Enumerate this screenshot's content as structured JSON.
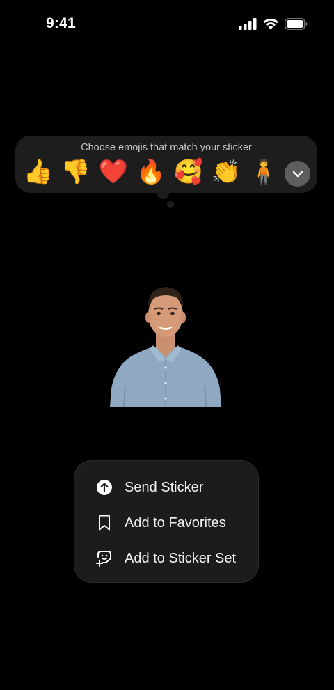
{
  "status_bar": {
    "time": "9:41",
    "icons": [
      "cellular-signal-icon",
      "wifi-icon",
      "battery-icon"
    ]
  },
  "emoji_picker": {
    "title": "Choose emojis that match your sticker",
    "emojis": [
      {
        "name": "thumbs-up",
        "glyph": "👍"
      },
      {
        "name": "thumbs-down",
        "glyph": "👎"
      },
      {
        "name": "red-heart",
        "glyph": "❤️"
      },
      {
        "name": "fire",
        "glyph": "🔥"
      },
      {
        "name": "smiling-face-with-hearts",
        "glyph": "🥰"
      },
      {
        "name": "clapping-hands",
        "glyph": "👏"
      },
      {
        "name": "person-standing",
        "glyph": "🧍"
      }
    ],
    "expand_icon": "chevron-down-icon"
  },
  "sticker": {
    "subject": "cutout photo of smiling man in light blue shirt"
  },
  "context_menu": {
    "items": [
      {
        "label": "Send Sticker",
        "icon": "arrow-up-circle-icon"
      },
      {
        "label": "Add to Favorites",
        "icon": "bookmark-icon"
      },
      {
        "label": "Add to Sticker Set",
        "icon": "sticker-add-icon"
      }
    ]
  },
  "colors": {
    "background": "#000000",
    "panel": "#1d1d1e",
    "menu": "#1c1c1e",
    "expand_button": "#5e5e61",
    "text_primary": "#f2f2f2",
    "text_secondary": "#c9c9cb"
  }
}
